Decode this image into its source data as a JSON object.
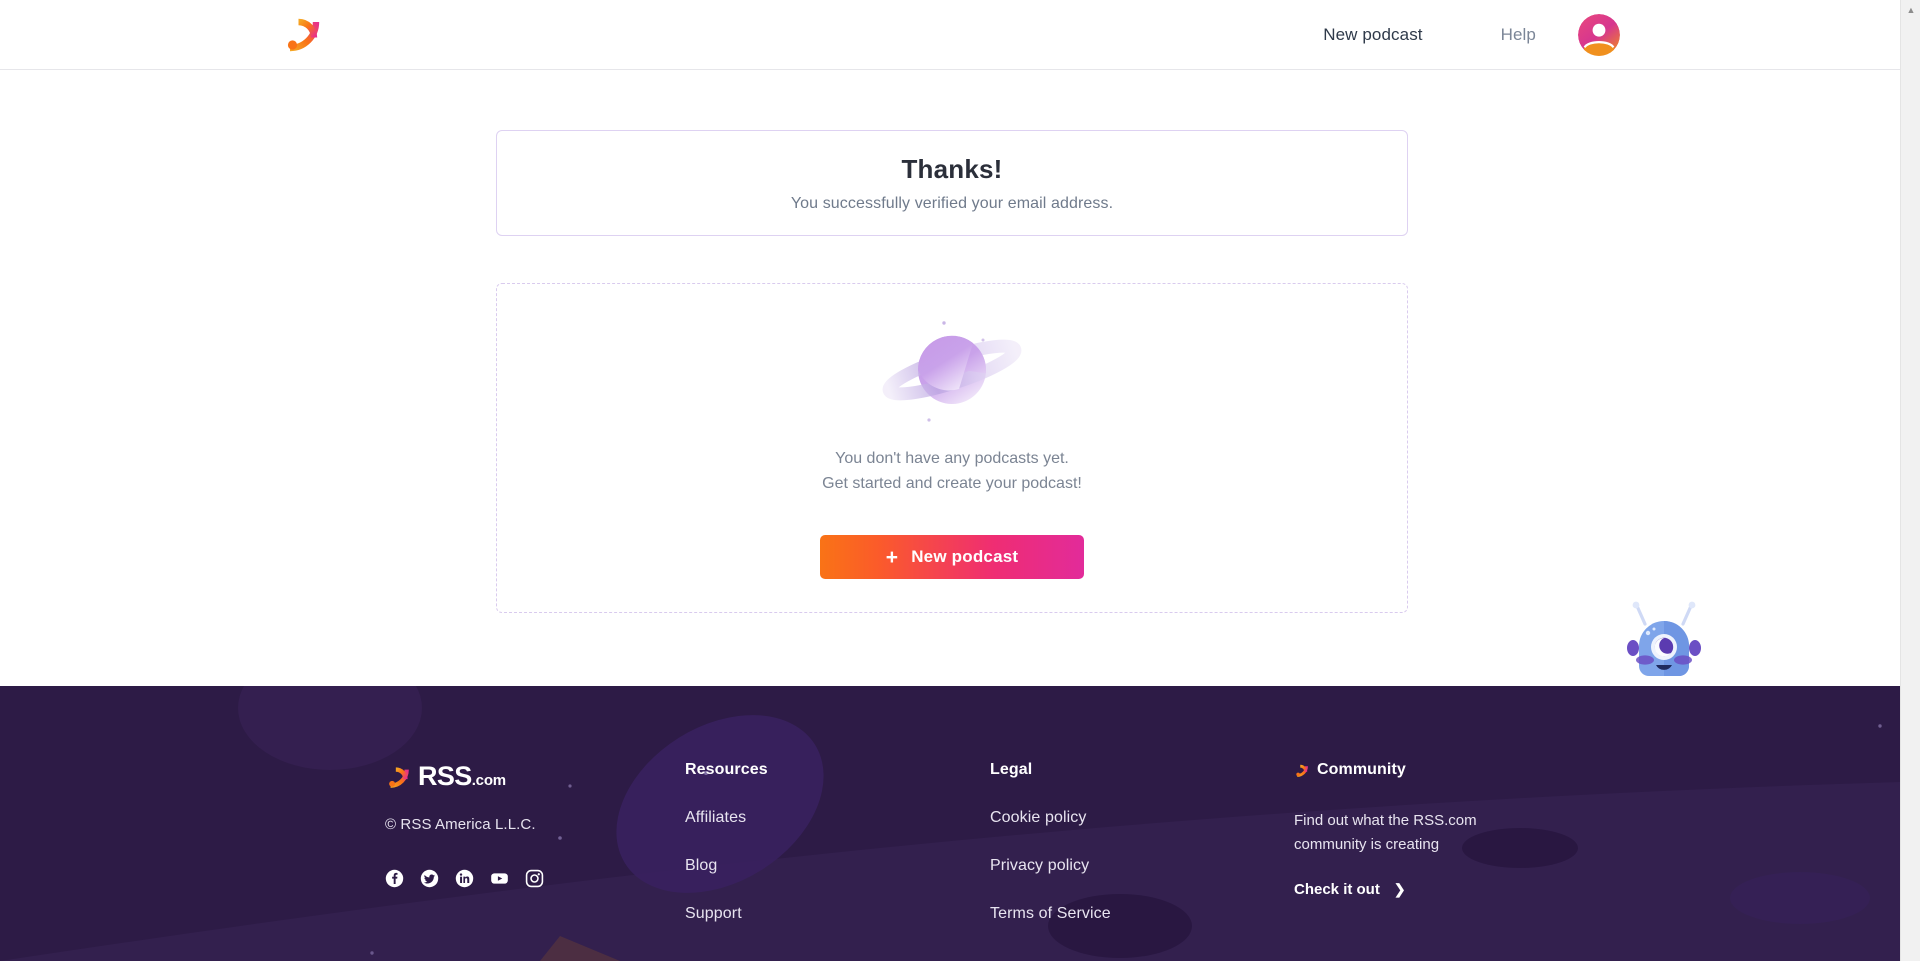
{
  "header": {
    "logo_icon": "rss-logo-icon",
    "nav": [
      {
        "label": "New podcast",
        "name": "nav-new-podcast"
      },
      {
        "label": "Help",
        "name": "nav-help"
      }
    ],
    "avatar_icon": "user-avatar-icon"
  },
  "thanks_card": {
    "title": "Thanks!",
    "subtitle": "You successfully verified your email address."
  },
  "empty_state": {
    "illustration": "planet-icon",
    "line1": "You don't have any podcasts yet.",
    "line2": "Get started and create your podcast!",
    "button_label": "New podcast",
    "button_plus": "+"
  },
  "mascot": {
    "icon": "chat-bot-mascot-icon"
  },
  "footer": {
    "brand": {
      "logo_icon": "rss-logo-icon",
      "name": "RSS",
      "suffix": ".com",
      "copyright": "© RSS America L.L.C.",
      "social": [
        {
          "name": "facebook-icon",
          "label": "Facebook"
        },
        {
          "name": "twitter-icon",
          "label": "Twitter"
        },
        {
          "name": "linkedin-icon",
          "label": "LinkedIn"
        },
        {
          "name": "youtube-icon",
          "label": "YouTube"
        },
        {
          "name": "instagram-icon",
          "label": "Instagram"
        }
      ]
    },
    "resources": {
      "heading": "Resources",
      "links": [
        {
          "label": "Affiliates"
        },
        {
          "label": "Blog"
        },
        {
          "label": "Support"
        }
      ]
    },
    "legal": {
      "heading": "Legal",
      "links": [
        {
          "label": "Cookie policy"
        },
        {
          "label": "Privacy policy"
        },
        {
          "label": "Terms of Service"
        }
      ]
    },
    "community": {
      "heading": "Community",
      "heading_icon": "rss-feed-icon",
      "text": "Find out what the RSS.com community is creating",
      "cta": "Check it out",
      "cta_chevron": "❯"
    }
  },
  "scrollbar": {
    "up": "▲",
    "down": "▼"
  },
  "colors": {
    "brand_orange": "#f97316",
    "brand_pink": "#e22b9a",
    "footer_bg": "#2d1b46",
    "card_border": "#ded2f2",
    "heading_text": "#2b2f3a",
    "muted_text": "#7b8493"
  }
}
